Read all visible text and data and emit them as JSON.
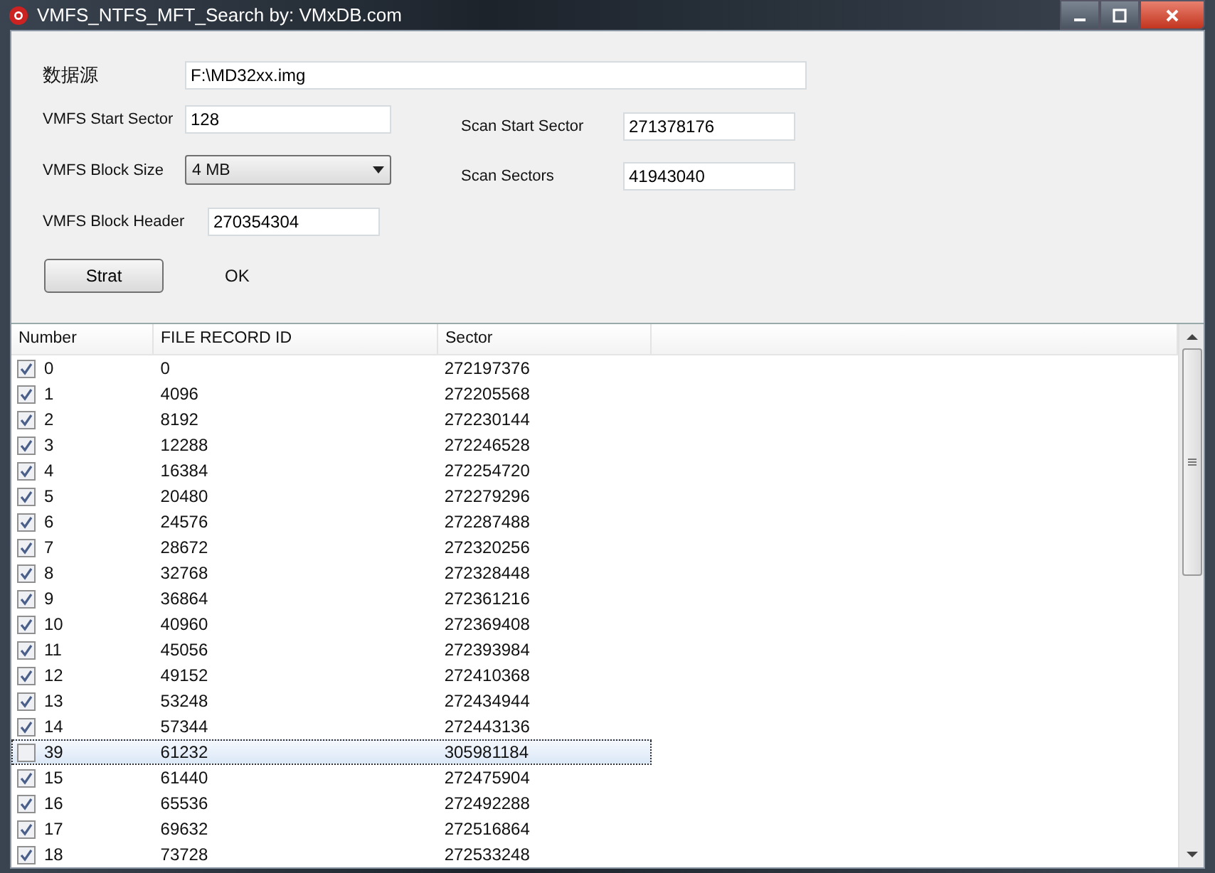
{
  "window": {
    "title": "VMFS_NTFS_MFT_Search by: VMxDB.com"
  },
  "source": {
    "label": "数据源",
    "value": "F:\\MD32xx.img"
  },
  "left_fields": [
    {
      "label": "VMFS Start Sector",
      "value": "128",
      "kind": "text"
    },
    {
      "label": "VMFS Block Size",
      "value": "4 MB",
      "kind": "combo"
    },
    {
      "label": "VMFS Block Header",
      "value": "270354304",
      "kind": "text"
    }
  ],
  "right_fields": [
    {
      "label": "Scan Start Sector",
      "value": "271378176",
      "kind": "text"
    },
    {
      "label": "Scan Sectors",
      "value": "41943040",
      "kind": "text"
    }
  ],
  "start_button": "Strat",
  "status": "OK",
  "table": {
    "columns": [
      "Number",
      "FILE RECORD ID",
      "Sector"
    ],
    "rows": [
      {
        "cells": [
          "0",
          "0",
          "272197376"
        ],
        "checked": true,
        "selected": false
      },
      {
        "cells": [
          "1",
          "4096",
          "272205568"
        ],
        "checked": true,
        "selected": false
      },
      {
        "cells": [
          "2",
          "8192",
          "272230144"
        ],
        "checked": true,
        "selected": false
      },
      {
        "cells": [
          "3",
          "12288",
          "272246528"
        ],
        "checked": true,
        "selected": false
      },
      {
        "cells": [
          "4",
          "16384",
          "272254720"
        ],
        "checked": true,
        "selected": false
      },
      {
        "cells": [
          "5",
          "20480",
          "272279296"
        ],
        "checked": true,
        "selected": false
      },
      {
        "cells": [
          "6",
          "24576",
          "272287488"
        ],
        "checked": true,
        "selected": false
      },
      {
        "cells": [
          "7",
          "28672",
          "272320256"
        ],
        "checked": true,
        "selected": false
      },
      {
        "cells": [
          "8",
          "32768",
          "272328448"
        ],
        "checked": true,
        "selected": false
      },
      {
        "cells": [
          "9",
          "36864",
          "272361216"
        ],
        "checked": true,
        "selected": false
      },
      {
        "cells": [
          "10",
          "40960",
          "272369408"
        ],
        "checked": true,
        "selected": false
      },
      {
        "cells": [
          "11",
          "45056",
          "272393984"
        ],
        "checked": true,
        "selected": false
      },
      {
        "cells": [
          "12",
          "49152",
          "272410368"
        ],
        "checked": true,
        "selected": false
      },
      {
        "cells": [
          "13",
          "53248",
          "272434944"
        ],
        "checked": true,
        "selected": false
      },
      {
        "cells": [
          "14",
          "57344",
          "272443136"
        ],
        "checked": true,
        "selected": false
      },
      {
        "cells": [
          "39",
          "61232",
          "305981184"
        ],
        "checked": false,
        "selected": true
      },
      {
        "cells": [
          "15",
          "61440",
          "272475904"
        ],
        "checked": true,
        "selected": false
      },
      {
        "cells": [
          "16",
          "65536",
          "272492288"
        ],
        "checked": true,
        "selected": false
      },
      {
        "cells": [
          "17",
          "69632",
          "272516864"
        ],
        "checked": true,
        "selected": false
      },
      {
        "cells": [
          "18",
          "73728",
          "272533248"
        ],
        "checked": true,
        "selected": false
      }
    ]
  }
}
